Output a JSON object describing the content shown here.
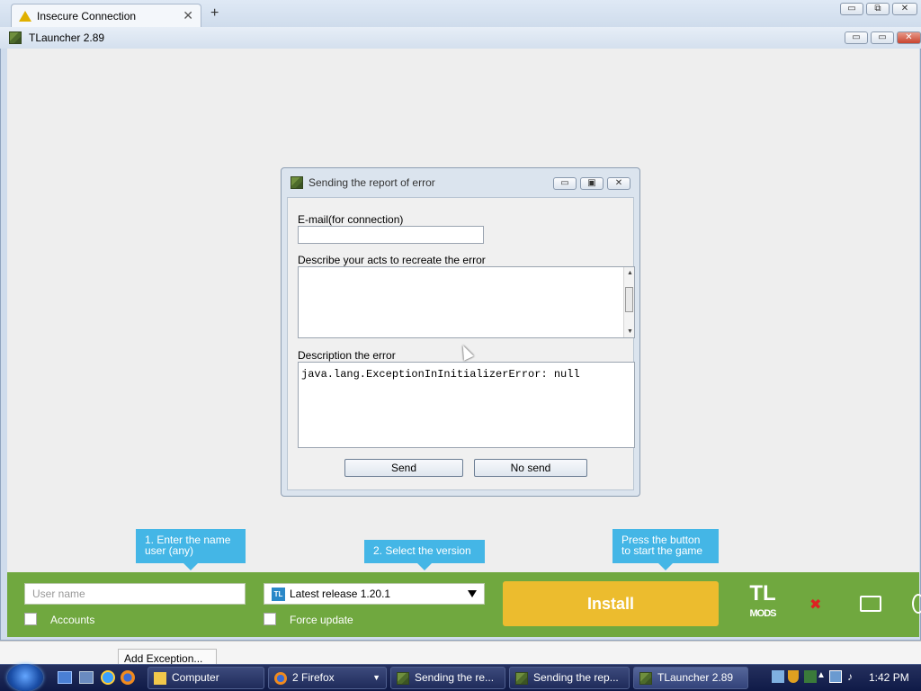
{
  "browser": {
    "tab_title": "Insecure Connection",
    "tab_close": "✕",
    "new_tab": "+",
    "win_min": "▭",
    "win_max": "⧉",
    "win_close": "✕"
  },
  "window": {
    "title": "TLauncher 2.89",
    "min": "▭",
    "max": "▭",
    "close": "✕"
  },
  "dialog": {
    "title": "Sending the report of error",
    "email_label": "E-mail(for connection)",
    "email_value": "",
    "describe_label": "Describe your acts to recreate the error",
    "describe_value": "",
    "error_label": "Description the error",
    "error_value": "java.lang.ExceptionInInitializerError: null",
    "send": "Send",
    "no_send": "No send",
    "min": "▭",
    "max": "▣",
    "close": "✕"
  },
  "launcher": {
    "tip_name": "1. Enter the name user (any)",
    "tip_version": "2. Select the version",
    "tip_start": "Press the button to start the game",
    "username_placeholder": "User name",
    "accounts_label": "Accounts",
    "version_value": "Latest release 1.20.1",
    "version_badge": "TL",
    "force_update_label": "Force update",
    "install": "Install",
    "mods_logo_top": "TL",
    "mods_logo_bottom": "MODS"
  },
  "below": {
    "add_exception": "Add Exception..."
  },
  "taskbar": {
    "computer": "Computer",
    "firefox": "2 Firefox",
    "sending1": "Sending the re...",
    "sending2": "Sending the rep...",
    "tlauncher": "TLauncher 2.89",
    "clock": "1:42 PM"
  },
  "colors": {
    "accent_green": "#70a83f",
    "install_yellow": "#ecbc2e",
    "tip_blue": "#44b6e6"
  }
}
